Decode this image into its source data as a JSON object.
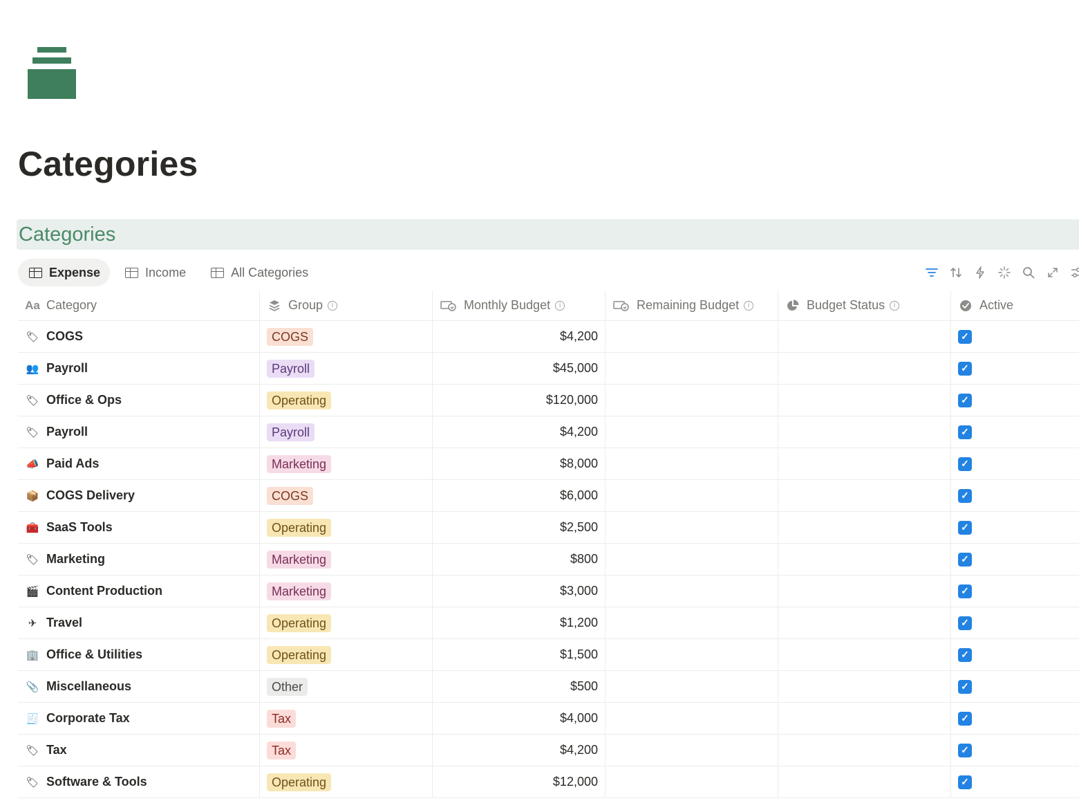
{
  "page": {
    "title": "Categories"
  },
  "database": {
    "title": "Categories",
    "tabs": [
      {
        "label": "Expense",
        "active": true
      },
      {
        "label": "Income",
        "active": false
      },
      {
        "label": "All Categories",
        "active": false
      }
    ]
  },
  "toolbar": {
    "icons": [
      "filter-icon",
      "sort-icon",
      "automation-icon",
      "ai-icon",
      "search-icon",
      "expand-icon",
      "settings-icon"
    ]
  },
  "columns": {
    "category": "Category",
    "group": "Group",
    "monthly_budget": "Monthly Budget",
    "remaining_budget": "Remaining Budget",
    "budget_status": "Budget Status",
    "active": "Active"
  },
  "group_colors": {
    "COGS": {
      "bg": "#fadfd3",
      "fg": "#7a3b23"
    },
    "Payroll": {
      "bg": "#eadcf5",
      "fg": "#5b3a78"
    },
    "Operating": {
      "bg": "#f8e7b4",
      "fg": "#6e5218"
    },
    "Marketing": {
      "bg": "#f6dbe7",
      "fg": "#7a2f52"
    },
    "Other": {
      "bg": "#ebebea",
      "fg": "#4a4944"
    },
    "Tax": {
      "bg": "#fcdcd9",
      "fg": "#8a2a22"
    }
  },
  "rows": [
    {
      "icon": "tag-icon",
      "emoji": "🏷",
      "category": "COGS",
      "group": "COGS",
      "monthly_budget": "$4,200",
      "active": true
    },
    {
      "icon": "people-icon",
      "emoji": "👥",
      "category": "Payroll",
      "group": "Payroll",
      "monthly_budget": "$45,000",
      "active": true
    },
    {
      "icon": "tag-icon",
      "emoji": "🏷",
      "category": "Office & Ops",
      "group": "Operating",
      "monthly_budget": "$120,000",
      "active": true
    },
    {
      "icon": "tag-icon",
      "emoji": "🏷",
      "category": "Payroll",
      "group": "Payroll",
      "monthly_budget": "$4,200",
      "active": true
    },
    {
      "icon": "megaphone-icon",
      "emoji": "📣",
      "category": "Paid Ads",
      "group": "Marketing",
      "monthly_budget": "$8,000",
      "active": true
    },
    {
      "icon": "package-icon",
      "emoji": "📦",
      "category": "COGS Delivery",
      "group": "COGS",
      "monthly_budget": "$6,000",
      "active": true
    },
    {
      "icon": "toolbox-icon",
      "emoji": "🧰",
      "category": "SaaS Tools",
      "group": "Operating",
      "monthly_budget": "$2,500",
      "active": true
    },
    {
      "icon": "tag-icon",
      "emoji": "🏷",
      "category": "Marketing",
      "group": "Marketing",
      "monthly_budget": "$800",
      "active": true
    },
    {
      "icon": "clapper-icon",
      "emoji": "🎬",
      "category": "Content Production",
      "group": "Marketing",
      "monthly_budget": "$3,000",
      "active": true
    },
    {
      "icon": "airplane-icon",
      "emoji": "✈",
      "category": "Travel",
      "group": "Operating",
      "monthly_budget": "$1,200",
      "active": true
    },
    {
      "icon": "office-icon",
      "emoji": "🏢",
      "category": "Office & Utilities",
      "group": "Operating",
      "monthly_budget": "$1,500",
      "active": true
    },
    {
      "icon": "paperclip-icon",
      "emoji": "📎",
      "category": "Miscellaneous",
      "group": "Other",
      "monthly_budget": "$500",
      "active": true
    },
    {
      "icon": "receipt-icon",
      "emoji": "🧾",
      "category": "Corporate Tax",
      "group": "Tax",
      "monthly_budget": "$4,000",
      "active": true
    },
    {
      "icon": "tag-icon",
      "emoji": "🏷",
      "category": "Tax",
      "group": "Tax",
      "monthly_budget": "$4,200",
      "active": true
    },
    {
      "icon": "tag-icon",
      "emoji": "🏷",
      "category": "Software & Tools",
      "group": "Operating",
      "monthly_budget": "$12,000",
      "active": true
    }
  ]
}
